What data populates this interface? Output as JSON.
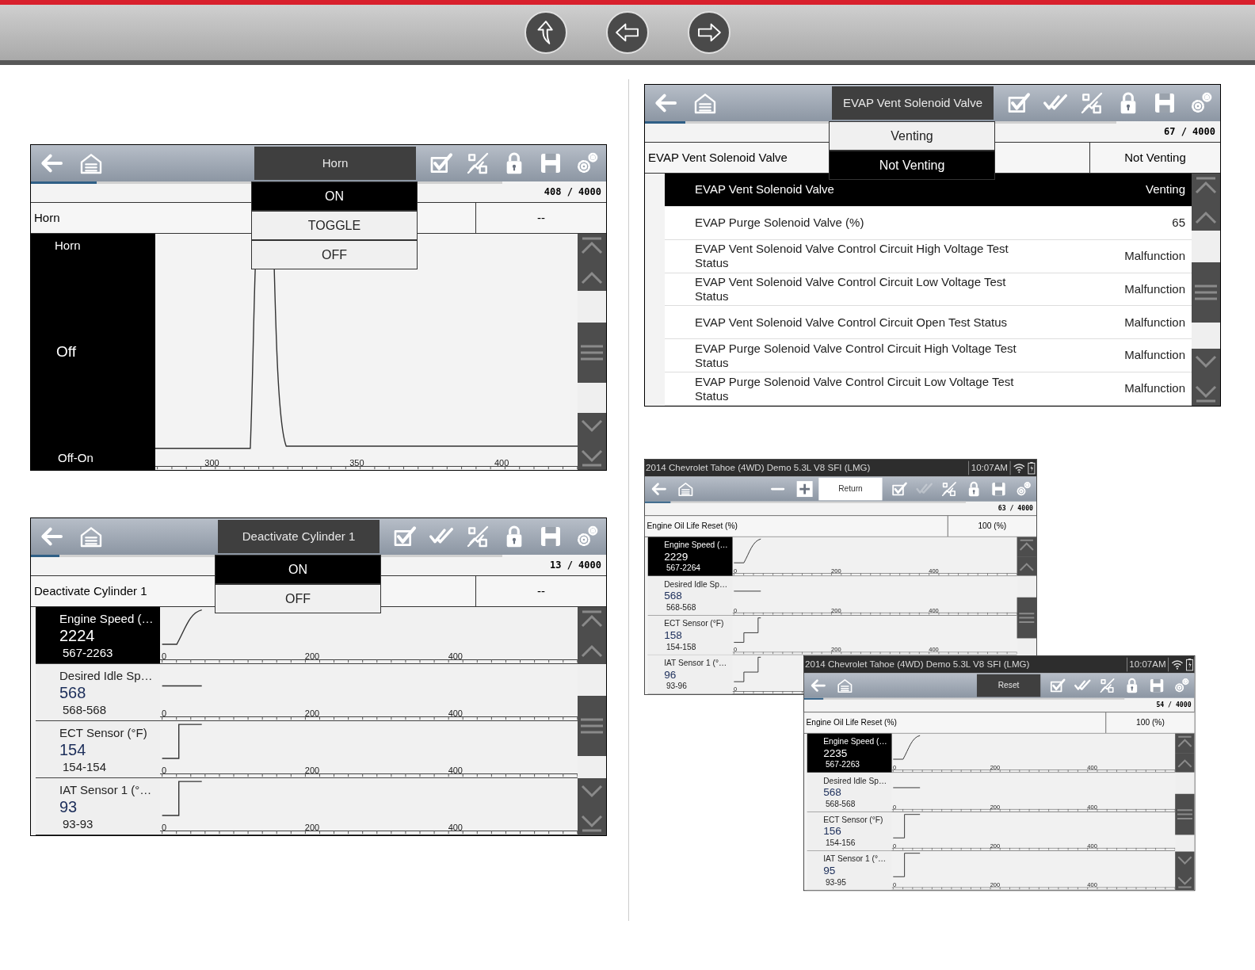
{
  "nav_buttons": [
    {
      "kind": "up"
    },
    {
      "kind": "back"
    },
    {
      "kind": "forward"
    }
  ],
  "screens": [
    {
      "toolbar": {
        "tools": [
          {
            "kind": "back"
          },
          {
            "kind": "home"
          },
          {
            "kind": "command",
            "label": "Horn",
            "active": true
          },
          {
            "kind": "check"
          },
          {
            "kind": "chart"
          },
          {
            "kind": "lock"
          },
          {
            "kind": "save"
          },
          {
            "kind": "settings"
          }
        ]
      },
      "menu": [
        {
          "label": "ON",
          "selected": true
        },
        {
          "label": "TOGGLE",
          "selected": false
        },
        {
          "label": "OFF",
          "selected": false
        }
      ],
      "progress": {
        "level": 0.14
      },
      "counter": "408 / 4000",
      "parameter": {
        "name": "Horn",
        "value": "--"
      },
      "body": {
        "kind": "single_graph",
        "name": "Horn",
        "value": "Off",
        "range": "Off-On",
        "selected": true,
        "ticks": [
          "300",
          "350",
          "400"
        ]
      }
    },
    {
      "toolbar": {
        "tools": [
          {
            "kind": "back"
          },
          {
            "kind": "home"
          },
          {
            "kind": "command",
            "label": "Deactivate Cylinder 1",
            "active": true
          },
          {
            "kind": "check"
          },
          {
            "kind": "double-check"
          },
          {
            "kind": "chart"
          },
          {
            "kind": "lock"
          },
          {
            "kind": "save"
          },
          {
            "kind": "settings"
          }
        ]
      },
      "menu": [
        {
          "label": "ON",
          "selected": true
        },
        {
          "label": "OFF",
          "selected": false
        }
      ],
      "progress": {
        "level": 0.06
      },
      "counter": "13 / 4000",
      "parameter": {
        "name": "Deactivate Cylinder 1",
        "value": "--"
      },
      "body": {
        "kind": "graph_rows",
        "rows": [
          {
            "kind": "rise",
            "name": "Engine Speed (…",
            "value": "2224",
            "range": "567-2263",
            "selected": true,
            "ticks": [
              "0",
              "200",
              "400"
            ]
          },
          {
            "kind": "flat",
            "name": "Desired Idle Sp…",
            "value": "568",
            "range": "568-568",
            "selected": false,
            "ticks": [
              "0",
              "200",
              "400"
            ]
          },
          {
            "kind": "step",
            "name": "ECT Sensor (°F)",
            "value": "154",
            "range": "154-154",
            "selected": false,
            "ticks": [
              "0",
              "200",
              "400"
            ]
          },
          {
            "kind": "step",
            "name": "IAT Sensor 1 (°…",
            "value": "93",
            "range": "93-93",
            "selected": false,
            "ticks": [
              "0",
              "200",
              "400"
            ]
          }
        ]
      }
    },
    {
      "toolbar": {
        "tools": [
          {
            "kind": "back"
          },
          {
            "kind": "home"
          },
          {
            "kind": "command",
            "label": "EVAP Vent Solenoid Valve",
            "active": true
          },
          {
            "kind": "check"
          },
          {
            "kind": "double-check"
          },
          {
            "kind": "chart"
          },
          {
            "kind": "lock"
          },
          {
            "kind": "save"
          },
          {
            "kind": "settings"
          }
        ]
      },
      "menu": [
        {
          "label": "Venting",
          "selected": false
        },
        {
          "label": "Not Venting",
          "selected": true
        }
      ],
      "progress": {
        "level": 0.085
      },
      "counter": "67 / 4000",
      "parameter": {
        "name": "EVAP Vent Solenoid Valve",
        "value": "Not Venting"
      },
      "body": {
        "kind": "list",
        "rows": [
          {
            "name": "EVAP Vent Solenoid Valve",
            "value": "Venting",
            "selected": true
          },
          {
            "name": "EVAP Purge Solenoid Valve (%)",
            "value": "65",
            "selected": false
          },
          {
            "name": "EVAP Vent Solenoid Valve Control Circuit High Voltage Test Status",
            "value": "Malfunction",
            "selected": false
          },
          {
            "name": "EVAP Vent Solenoid Valve Control Circuit Low Voltage Test Status",
            "value": "Malfunction",
            "selected": false
          },
          {
            "name": "EVAP Vent Solenoid Valve Control Circuit Open Test Status",
            "value": "Malfunction",
            "selected": false
          },
          {
            "name": "EVAP Purge Solenoid Valve Control Circuit High Voltage Test Status",
            "value": "Malfunction",
            "selected": false
          },
          {
            "name": "EVAP Purge Solenoid Valve Control Circuit Low Voltage Test Status",
            "value": "Malfunction",
            "selected": false
          }
        ]
      }
    },
    {
      "status_bar": {
        "title": "2014 Chevrolet Tahoe (4WD) Demo 5.3L V8 SFI (LMG)",
        "time": "10:07AM"
      },
      "toolbar": {
        "tools": [
          {
            "kind": "back"
          },
          {
            "kind": "home"
          },
          {
            "kind": "minus"
          },
          {
            "kind": "plus"
          },
          {
            "kind": "command",
            "label": "Return",
            "active": false
          },
          {
            "kind": "check"
          },
          {
            "kind": "double-check",
            "disabled": true
          },
          {
            "kind": "chart"
          },
          {
            "kind": "lock"
          },
          {
            "kind": "save"
          },
          {
            "kind": "settings"
          }
        ]
      },
      "progress": {
        "level": 0.08
      },
      "counter": "63 / 4000",
      "parameter": {
        "name": "Engine Oil Life Reset (%)",
        "value": "100 (%)"
      },
      "body": {
        "kind": "graph_rows",
        "rows": [
          {
            "kind": "rise",
            "name": "Engine Speed (…",
            "value": "2229",
            "range": "567-2264",
            "selected": true,
            "ticks": [
              "0",
              "200",
              "400"
            ]
          },
          {
            "kind": "flat",
            "name": "Desired Idle Sp…",
            "value": "568",
            "range": "568-568",
            "selected": false,
            "ticks": [
              "0",
              "200",
              "400"
            ]
          },
          {
            "kind": "double-step",
            "name": "ECT Sensor (°F)",
            "value": "158",
            "range": "154-158",
            "selected": false,
            "ticks": [
              "0",
              "200",
              "400"
            ]
          },
          {
            "kind": "double-step",
            "name": "IAT Sensor 1 (°…",
            "value": "96",
            "range": "93-96",
            "selected": false,
            "ticks": [
              "0"
            ]
          }
        ]
      }
    },
    {
      "status_bar": {
        "title": "2014 Chevrolet Tahoe (4WD) Demo 5.3L V8 SFI (LMG)",
        "time": "10:07AM"
      },
      "toolbar": {
        "tools": [
          {
            "kind": "back"
          },
          {
            "kind": "home"
          },
          {
            "kind": "command",
            "label": "Reset",
            "active": true
          },
          {
            "kind": "check"
          },
          {
            "kind": "double-check"
          },
          {
            "kind": "chart"
          },
          {
            "kind": "lock"
          },
          {
            "kind": "save"
          },
          {
            "kind": "settings"
          }
        ]
      },
      "progress": {
        "level": 0.06
      },
      "counter": "54 / 4000",
      "parameter": {
        "name": "Engine Oil Life Reset (%)",
        "value": "100 (%)"
      },
      "body": {
        "kind": "graph_rows",
        "rows": [
          {
            "kind": "rise",
            "name": "Engine Speed (…",
            "value": "2235",
            "range": "567-2263",
            "selected": true,
            "ticks": [
              "0",
              "200",
              "400"
            ]
          },
          {
            "kind": "flat",
            "name": "Desired Idle Sp…",
            "value": "568",
            "range": "568-568",
            "selected": false,
            "ticks": [
              "0",
              "200",
              "400"
            ]
          },
          {
            "kind": "step",
            "name": "ECT Sensor (°F)",
            "value": "156",
            "range": "154-156",
            "selected": false,
            "ticks": [
              "0",
              "200",
              "400"
            ]
          },
          {
            "kind": "step",
            "name": "IAT Sensor 1 (°…",
            "value": "95",
            "range": "93-95",
            "selected": false,
            "ticks": [
              "0",
              "200",
              "400"
            ]
          }
        ]
      }
    }
  ]
}
